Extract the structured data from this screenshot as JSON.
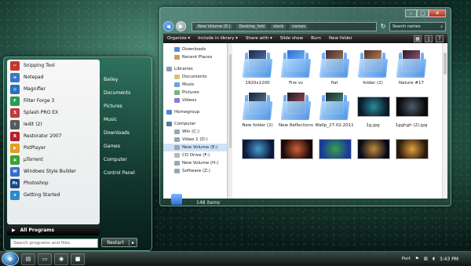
{
  "explorer": {
    "breadcrumbs": [
      "New Volume (E:)",
      "Desktop_fold",
      "stock",
      "names"
    ],
    "search_placeholder": "Search names",
    "toolbar": [
      "Organize ▾",
      "Include in library ▾",
      "Share with ▾",
      "Slide show",
      "Burn",
      "New folder"
    ],
    "nav": {
      "favorites": [
        {
          "label": "Downloads",
          "icon": "downloads-icon",
          "color": "#5a8bd6"
        },
        {
          "label": "Recent Places",
          "icon": "recent-places-icon",
          "color": "#c9a24a"
        }
      ],
      "libraries_label": "Libraries",
      "libraries": [
        {
          "label": "Documents",
          "icon": "documents-icon",
          "color": "#d9c27a"
        },
        {
          "label": "Music",
          "icon": "music-icon",
          "color": "#6fa0d8"
        },
        {
          "label": "Pictures",
          "icon": "pictures-icon",
          "color": "#7cb37c"
        },
        {
          "label": "Videos",
          "icon": "videos-icon",
          "color": "#8a7bd0"
        }
      ],
      "homegroup_label": "Homegroup",
      "computer_label": "Computer",
      "drives": [
        {
          "label": "Win (C:)",
          "icon": "drive-icon",
          "color": "#9aa7b0",
          "selected": false
        },
        {
          "label": "Video 1 (D:)",
          "icon": "drive-icon",
          "color": "#9aa7b0",
          "selected": false
        },
        {
          "label": "New Volume (E:)",
          "icon": "drive-icon",
          "color": "#9aa7b0",
          "selected": true
        },
        {
          "label": "CD Drive (F:)",
          "icon": "cd-drive-icon",
          "color": "#b8b8b8",
          "selected": false
        },
        {
          "label": "New Volume (H:)",
          "icon": "drive-icon",
          "color": "#9aa7b0",
          "selected": false
        },
        {
          "label": "Software (Z:)",
          "icon": "drive-icon",
          "color": "#9aa7b0",
          "selected": false
        }
      ]
    },
    "items": [
      {
        "name": "1920x1200",
        "kind": "folder",
        "c1": "#1b2a4a",
        "c2": "#5f86c2"
      },
      {
        "name": "Fire vs",
        "kind": "folder",
        "c1": "#2c6fd0",
        "c2": "#8cc4ff"
      },
      {
        "name": "flat",
        "kind": "folder",
        "c1": "#3a2a3a",
        "c2": "#c08a5a"
      },
      {
        "name": "folder (2)",
        "kind": "folder",
        "c1": "#4a2e2a",
        "c2": "#d8a070"
      },
      {
        "name": "Nature #17",
        "kind": "folder",
        "c1": "#2a1a2e",
        "c2": "#b06a8a"
      },
      {
        "name": "New folder (2)",
        "kind": "folder",
        "c1": "#14263a",
        "c2": "#6a8aa8"
      },
      {
        "name": "New Reflections",
        "kind": "folder",
        "c1": "#1a1a2a",
        "c2": "#c05a5a"
      },
      {
        "name": "Wallp_27.02.2011",
        "kind": "folder",
        "c1": "#1a2a2a",
        "c2": "#5a9a8a"
      },
      {
        "name": "1g.jpg",
        "kind": "photo",
        "c1": "#0a1a2a",
        "c2": "#2a8a9a"
      },
      {
        "name": "1gghgh (2).jpg",
        "kind": "photo",
        "c1": "#0a0a0a",
        "c2": "#4a5a6a"
      },
      {
        "name": "",
        "kind": "photo",
        "c1": "#0a1a3a",
        "c2": "#4a9ad0"
      },
      {
        "name": "",
        "kind": "photo",
        "c1": "#1a0a0a",
        "c2": "#d0603a"
      },
      {
        "name": "",
        "kind": "photo",
        "c1": "#1a3a9a",
        "c2": "#3aa04a"
      },
      {
        "name": "",
        "kind": "photo",
        "c1": "#0a0a1a",
        "c2": "#c08a3a"
      },
      {
        "name": "",
        "kind": "photo",
        "c1": "#2a1a0a",
        "c2": "#e0a040"
      }
    ],
    "status": "148 items"
  },
  "startmenu": {
    "programs": [
      {
        "label": "Snipping Tool",
        "icon": "snipping-tool-icon",
        "color": "#c0392b",
        "glyph": "✂"
      },
      {
        "label": "Notepad",
        "icon": "notepad-icon",
        "color": "#3a78c2",
        "glyph": "≡"
      },
      {
        "label": "Magnifier",
        "icon": "magnifier-icon",
        "color": "#2a6fc2",
        "glyph": "◎"
      },
      {
        "label": "Filter Forge 3",
        "icon": "filter-forge-icon",
        "color": "#2a9a5a",
        "glyph": "F"
      },
      {
        "label": "Splash PRO EX",
        "icon": "splash-icon",
        "color": "#c23a3a",
        "glyph": "S"
      },
      {
        "label": "Iedit (2)",
        "icon": "iedit-icon",
        "color": "#5a5a5a",
        "glyph": "i"
      },
      {
        "label": "Restorator 2007",
        "icon": "restorator-icon",
        "color": "#b8202a",
        "glyph": "R"
      },
      {
        "label": "PotPlayer",
        "icon": "potplayer-icon",
        "color": "#e0a020",
        "glyph": "▶"
      },
      {
        "label": "µTorrent",
        "icon": "utorrent-icon",
        "color": "#3aa03a",
        "glyph": "µ"
      },
      {
        "label": "Windows Style Builder",
        "icon": "style-builder-icon",
        "color": "#3a6ad0",
        "glyph": "W"
      },
      {
        "label": "Photoshop",
        "icon": "photoshop-icon",
        "color": "#1a4a8a",
        "glyph": "Ps"
      },
      {
        "label": "Getting Started",
        "icon": "getting-started-icon",
        "color": "#2a8ad0",
        "glyph": "★"
      }
    ],
    "all_programs": "All Programs",
    "search_placeholder": "Search programs and files",
    "right": [
      "Bailey",
      "Documents",
      "Pictures",
      "Music",
      "Downloads",
      "Games",
      "Computer",
      "Control Panel"
    ],
    "restart": "Restart"
  },
  "taskbar": {
    "apps": [
      {
        "icon": "folder-icon",
        "glyph": "▤"
      },
      {
        "icon": "window-icon",
        "glyph": "▭"
      },
      {
        "icon": "chrome-icon",
        "glyph": "◉"
      },
      {
        "icon": "app-icon",
        "glyph": "■"
      }
    ],
    "tray_label": "Port",
    "clock": "3:43 PM"
  }
}
